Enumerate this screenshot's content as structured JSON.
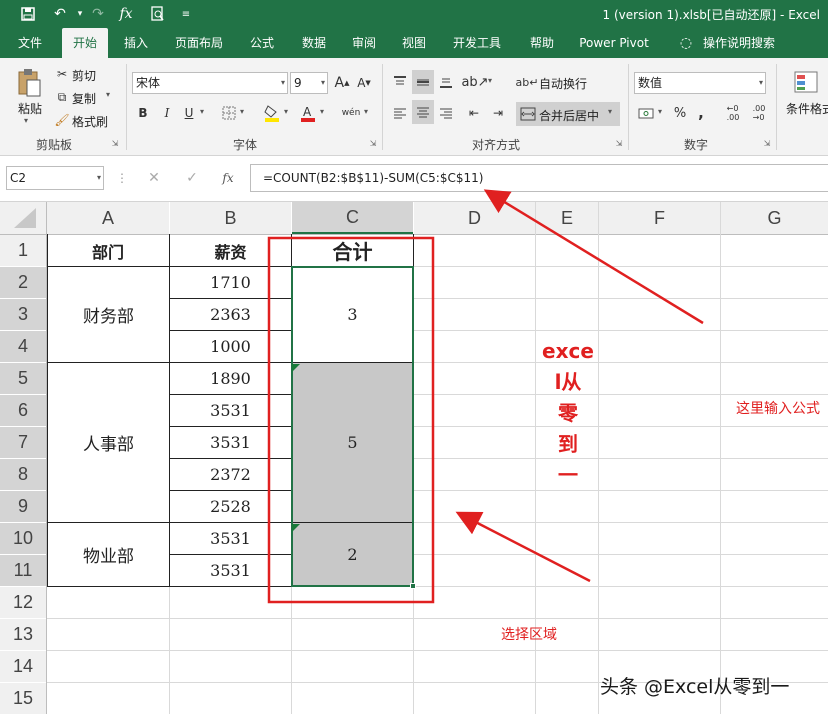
{
  "title_bar": {
    "window_title": "1 (version 1).xlsb[已自动还原]  -  Excel",
    "icons": [
      "save-icon",
      "undo-icon",
      "redo-icon",
      "function-icon",
      "print-preview-icon",
      "customize-icon"
    ]
  },
  "tabs": [
    "文件",
    "开始",
    "插入",
    "页面布局",
    "公式",
    "数据",
    "审阅",
    "视图",
    "开发工具",
    "帮助",
    "Power Pivot",
    "操作说明搜索"
  ],
  "active_tab": "开始",
  "ribbon": {
    "clipboard": {
      "paste": "粘贴",
      "cut": "剪切",
      "copy": "复制",
      "format_painter": "格式刷",
      "label": "剪贴板"
    },
    "font": {
      "name": "宋体",
      "size": "9",
      "bold": "B",
      "italic": "I",
      "underline": "U",
      "grow": "A",
      "shrink": "A",
      "label": "字体"
    },
    "alignment": {
      "wrap": "自动换行",
      "merge": "合并后居中",
      "label": "对齐方式"
    },
    "number": {
      "format": "数值",
      "percent": "%",
      "comma": ",",
      "label": "数字"
    },
    "styles": {
      "conditional": "条件格式"
    }
  },
  "formula_bar": {
    "name_box": "C2",
    "fx": "fx",
    "formula": "=COUNT(B2:$B$11)-SUM(C5:$C$11)"
  },
  "sheet": {
    "columns": [
      "A",
      "B",
      "C",
      "D",
      "E",
      "F",
      "G"
    ],
    "rows": [
      "1",
      "2",
      "3",
      "4",
      "5",
      "6",
      "7",
      "8",
      "9",
      "10",
      "11",
      "12",
      "13",
      "14",
      "15"
    ],
    "headers": {
      "dept": "部门",
      "salary": "薪资",
      "total": "合计"
    },
    "departments": [
      "财务部",
      "人事部",
      "物业部"
    ],
    "salaries": [
      "1710",
      "2363",
      "1000",
      "1890",
      "3531",
      "3531",
      "2372",
      "2528",
      "3531",
      "3531"
    ],
    "totals": [
      "3",
      "5",
      "2"
    ]
  },
  "annotations": {
    "vertical_lines": [
      "exce",
      "l从",
      "零",
      "到",
      "一"
    ],
    "formula_hint": "这里输入公式",
    "select_hint": "选择区域",
    "watermark": "头条 @Excel从零到一",
    "accent_color": "#e02020"
  }
}
